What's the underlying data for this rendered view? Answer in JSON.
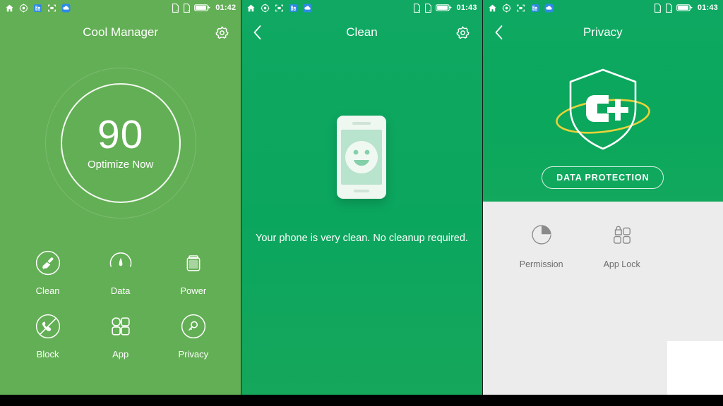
{
  "statusbar": {
    "icons": [
      "home-icon",
      "location-icon",
      "building-icon",
      "screenshot-icon",
      "cloud-icon"
    ],
    "right_icons": [
      "sim1-icon",
      "sim2-icon",
      "battery-icon"
    ],
    "time_panel1": "01:42",
    "time_panel2": "01:43",
    "time_panel3": "01:43"
  },
  "colors": {
    "panel1_green": "#63af55",
    "panel2_green": "#0ba65e",
    "panel3_green": "#0aa75c",
    "panel3_gray": "#ececec",
    "orbit_yellow": "#e8d23a",
    "label_gray": "#6d6d6d"
  },
  "panel1": {
    "title": "Cool Manager",
    "gear_icon": "gear-icon",
    "score": "90",
    "score_action": "Optimize Now",
    "tiles": [
      {
        "label": "Clean",
        "icon": "broom-icon"
      },
      {
        "label": "Data",
        "icon": "gauge-icon"
      },
      {
        "label": "Power",
        "icon": "battery-icon"
      },
      {
        "label": "Block",
        "icon": "call-block-icon"
      },
      {
        "label": "App",
        "icon": "apps-grid-icon"
      },
      {
        "label": "Privacy",
        "icon": "key-icon"
      }
    ]
  },
  "panel2": {
    "title": "Clean",
    "back_icon": "chevron-left-icon",
    "gear_icon": "gear-icon",
    "illustration": "phone-smiley-icon",
    "message": "Your phone is very clean. No cleanup required."
  },
  "panel3": {
    "title": "Privacy",
    "back_icon": "chevron-left-icon",
    "logo": "shield-c-plus-logo",
    "logo_text": "C+",
    "button_label": "DATA PROTECTION",
    "tiles": [
      {
        "label": "Permission",
        "icon": "pie-chart-icon"
      },
      {
        "label": "App Lock",
        "icon": "app-lock-icon"
      }
    ]
  }
}
